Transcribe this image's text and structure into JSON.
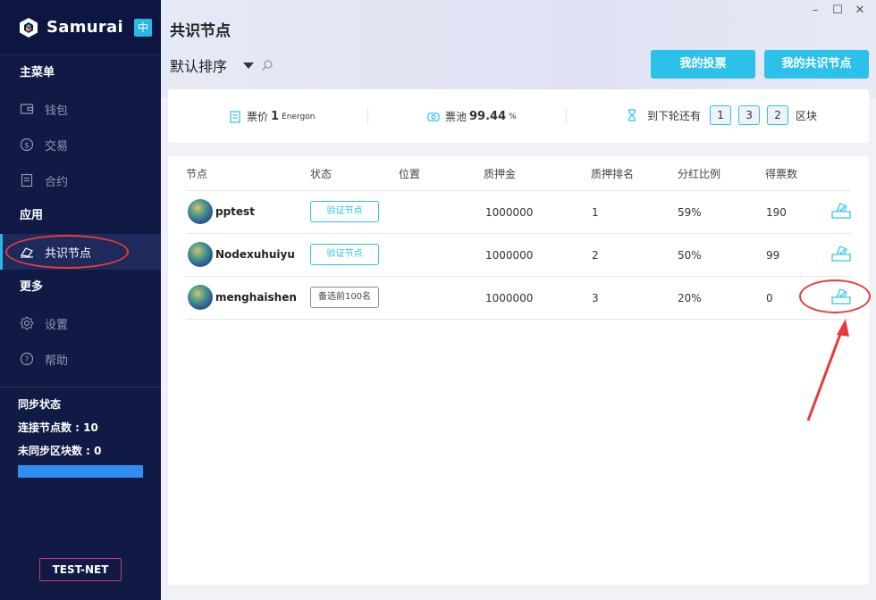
{
  "brand": {
    "name": "Samurai",
    "lang_badge": "中"
  },
  "sidebar": {
    "main_menu_title": "主菜单",
    "main_items": [
      {
        "label": "钱包",
        "icon": "wallet-icon"
      },
      {
        "label": "交易",
        "icon": "dollar-icon"
      },
      {
        "label": "合约",
        "icon": "contract-icon"
      }
    ],
    "apps_title": "应用",
    "app_items": [
      {
        "label": "共识节点",
        "icon": "vote-hand-icon",
        "active": true
      }
    ],
    "more_title": "更多",
    "more_items": [
      {
        "label": "设置",
        "icon": "gear-icon"
      },
      {
        "label": "帮助",
        "icon": "help-icon"
      }
    ],
    "sync": {
      "title": "同步状态",
      "connected_label": "连接节点数 :",
      "connected_value": "10",
      "unsynced_label": "未同步区块数 :",
      "unsynced_value": "0"
    },
    "network_badge": "TEST-NET"
  },
  "main": {
    "title": "共识节点",
    "sort_label": "默认排序",
    "buttons": {
      "my_votes": "我的投票",
      "my_nodes": "我的共识节点"
    },
    "stats": {
      "ticket_price_label": "票价",
      "ticket_price_value": "1",
      "ticket_price_unit": "Energon",
      "pool_label": "票池",
      "pool_value": "99.44",
      "pool_unit": "%",
      "next_round_label": "到下轮还有",
      "next_round_digits": [
        "1",
        "3",
        "2"
      ],
      "block_unit": "区块"
    },
    "table": {
      "headers": [
        "节点",
        "状态",
        "位置",
        "质押金",
        "质押排名",
        "分红比例",
        "得票数"
      ],
      "rows": [
        {
          "name": "pptest",
          "status": "验证节点",
          "status_type": "verify",
          "location": "",
          "stake": "1000000",
          "rank": "1",
          "dividend": "59%",
          "votes": "190"
        },
        {
          "name": "Nodexuhuiyu",
          "status": "验证节点",
          "status_type": "verify",
          "location": "",
          "stake": "1000000",
          "rank": "2",
          "dividend": "50%",
          "votes": "99"
        },
        {
          "name": "menghaishen",
          "status": "备选前100名",
          "status_type": "backup",
          "location": "",
          "stake": "1000000",
          "rank": "3",
          "dividend": "20%",
          "votes": "0"
        }
      ]
    }
  },
  "colors": {
    "accent": "#2cc1e8",
    "sidebar_bg": "#101a44",
    "annotation": "#e83a3a"
  }
}
